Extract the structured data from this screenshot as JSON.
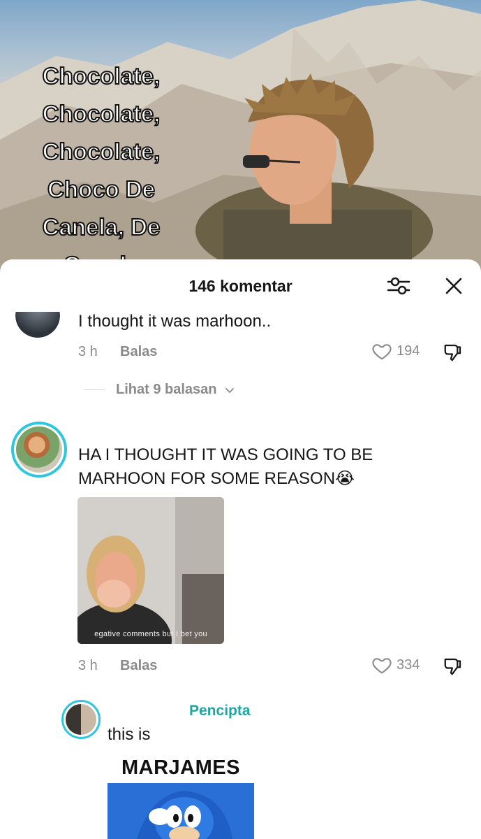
{
  "video": {
    "caption_lines": [
      "Chocolate,",
      "Chocolate,",
      "Chocolate,",
      "Choco De",
      "Canela, De",
      "Canela"
    ]
  },
  "comments_panel": {
    "title": "146 komentar",
    "filter_icon": "sliders-icon",
    "close_icon": "close-icon"
  },
  "comments": [
    {
      "text": "I thought it was marhoon..",
      "time": "3 h",
      "reply_label": "Balas",
      "likes": "194",
      "view_replies": "Lihat 9 balasan"
    },
    {
      "text": "HA I THOUGHT IT WAS GOING TO BE MARHOON FOR SOME REASON😭",
      "gif_caption": "egative comments but I bet you",
      "time": "3 h",
      "reply_label": "Balas",
      "likes": "334"
    }
  ],
  "reply": {
    "creator_label": "Pencipta",
    "text": "this is",
    "sticker_text": "MARJAMES"
  },
  "colors": {
    "accent_teal": "#20a7a1",
    "story_ring": "#2fc6e0",
    "text": "#161616",
    "meta": "#8a8a8a"
  }
}
